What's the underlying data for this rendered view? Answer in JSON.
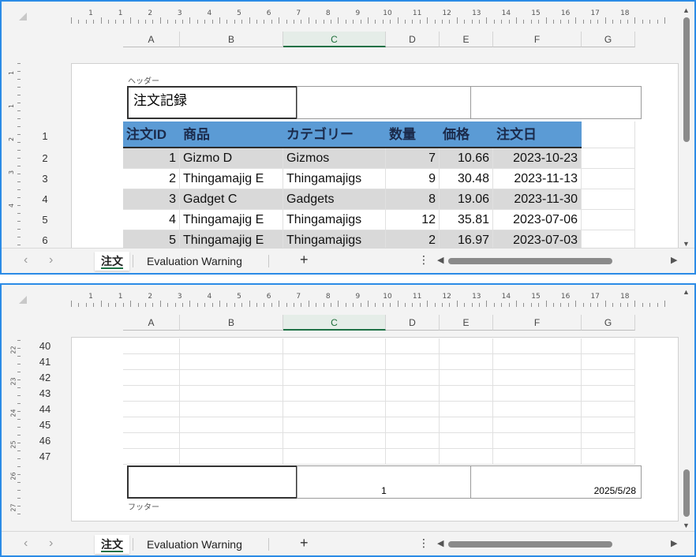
{
  "columns": [
    "A",
    "B",
    "C",
    "D",
    "E",
    "F",
    "G"
  ],
  "selected_column": "C",
  "ruler_numbers": [
    "1",
    "1",
    "2",
    "3",
    "4",
    "5",
    "6",
    "7",
    "8",
    "9",
    "10",
    "11",
    "12",
    "13",
    "14",
    "15",
    "16",
    "17",
    "18"
  ],
  "top_pane": {
    "header_label": "ヘッダー",
    "header_sections": [
      "注文記録",
      "",
      ""
    ],
    "row_numbers": [
      "1",
      "2",
      "3",
      "4",
      "5",
      "6"
    ],
    "table": {
      "headers": [
        "注文ID",
        "商品",
        "カテゴリー",
        "数量",
        "価格",
        "注文日"
      ],
      "rows": [
        [
          "1",
          "Gizmo D",
          "Gizmos",
          "7",
          "10.66",
          "2023-10-23"
        ],
        [
          "2",
          "Thingamajig E",
          "Thingamajigs",
          "9",
          "30.48",
          "2023-11-13"
        ],
        [
          "3",
          "Gadget C",
          "Gadgets",
          "8",
          "19.06",
          "2023-11-30"
        ],
        [
          "4",
          "Thingamajig E",
          "Thingamajigs",
          "12",
          "35.81",
          "2023-07-06"
        ],
        [
          "5",
          "Thingamajig E",
          "Thingamajigs",
          "2",
          "16.97",
          "2023-07-03"
        ]
      ]
    },
    "vruler_numbers": [
      "1",
      "1",
      "2",
      "3",
      "4"
    ]
  },
  "bottom_pane": {
    "row_numbers": [
      "40",
      "41",
      "42",
      "43",
      "44",
      "45",
      "46",
      "47"
    ],
    "footer_label": "フッター",
    "footer_sections": [
      "",
      "1",
      "2025/5/28"
    ],
    "vruler_numbers": [
      "22",
      "23",
      "24",
      "25",
      "26",
      "27"
    ]
  },
  "tabs": {
    "nav_prev": "‹",
    "nav_next": "›",
    "sheets": [
      "注文",
      "Evaluation Warning"
    ],
    "active_sheet": "注文",
    "add_sheet": "+",
    "more": "⋮"
  },
  "colors": {
    "accent_border": "#2b8be6",
    "header_fill": "#5b9bd5",
    "band_fill": "#d9d9d9",
    "selected_col": "#1e7145"
  }
}
